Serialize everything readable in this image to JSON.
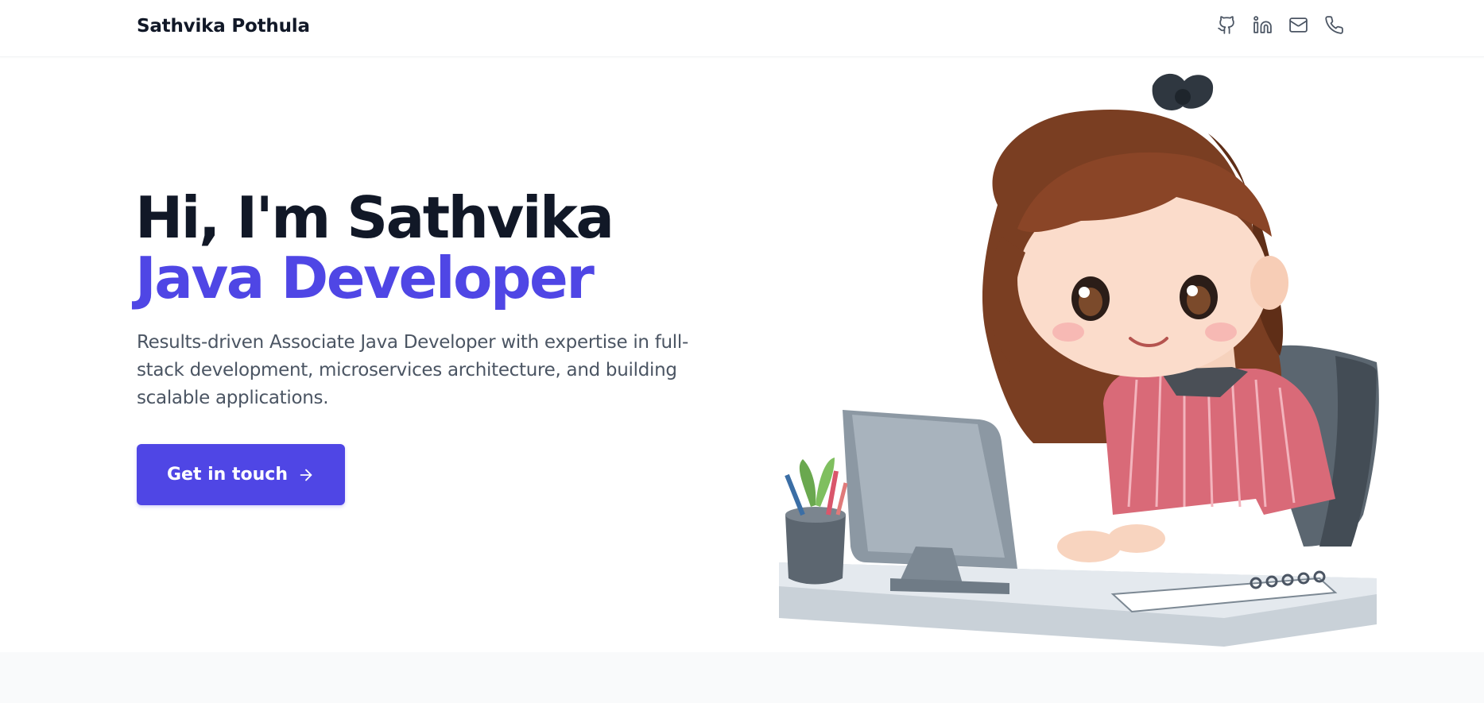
{
  "nav": {
    "brand": "Sathvika Pothula",
    "icons": [
      "github-icon",
      "linkedin-icon",
      "mail-icon",
      "phone-icon"
    ]
  },
  "hero": {
    "greeting": "Hi, I'm Sathvika",
    "role": "Java Developer",
    "description": "Results-driven Associate Java Developer with expertise in full-stack development, microservices architecture, and building scalable applications.",
    "cta_label": "Get in touch",
    "cta_icon": "arrow-right-icon"
  },
  "colors": {
    "accent": "#4f46e5",
    "heading": "#111827",
    "body_text": "#4b5563",
    "section_bg": "#f9fafb"
  }
}
